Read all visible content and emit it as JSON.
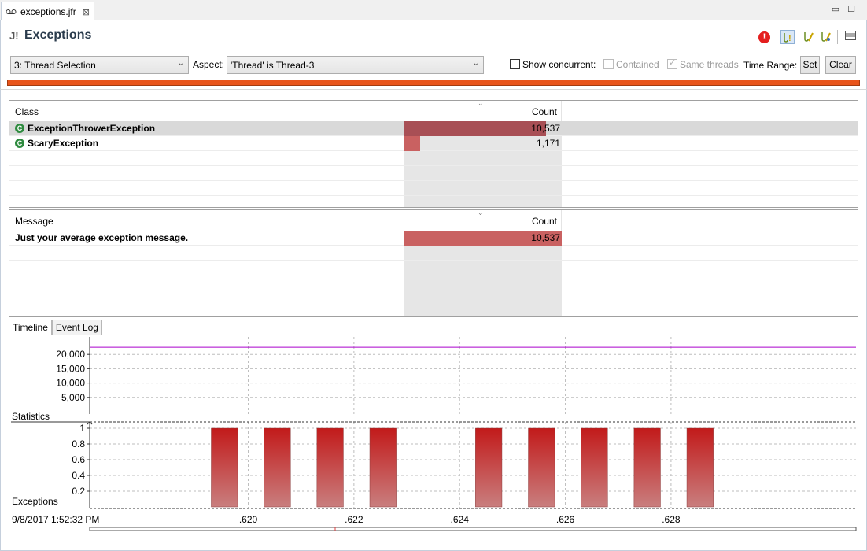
{
  "editor_tab": {
    "label": "exceptions.jfr",
    "close": "⊠"
  },
  "window": {
    "minimize": "▭",
    "maximize": "☐"
  },
  "header": {
    "icon": "J!",
    "title": "Exceptions",
    "error_icon": "!"
  },
  "toolbar": {
    "icons": [
      "show-exceptions-icon",
      "show-errors-icon",
      "show-all-icon",
      "table-settings-icon"
    ]
  },
  "filters": {
    "selection_value": "3: Thread Selection",
    "aspect_label": "Aspect:",
    "aspect_value": "'Thread' is Thread-3",
    "show_concurrent": "Show concurrent:",
    "contained": "Contained",
    "same_threads": "Same threads",
    "time_range": "Time Range:",
    "set": "Set",
    "clear": "Clear"
  },
  "class_table": {
    "headers": {
      "name": "Class",
      "count": "Count"
    },
    "rows": [
      {
        "name": "ExceptionThrowerException",
        "count": "10,537",
        "fraction": 0.902
      },
      {
        "name": "ScaryException",
        "count": "1,171",
        "fraction": 0.1
      }
    ]
  },
  "message_table": {
    "headers": {
      "name": "Message",
      "count": "Count"
    },
    "rows": [
      {
        "name": "Just your average exception message.",
        "count": "10,537",
        "fraction": 1.0
      }
    ]
  },
  "view_tabs": {
    "timeline": "Timeline",
    "event_log": "Event Log"
  },
  "timeline": {
    "start_label": "9/8/2017 1:52:32 PM",
    "x_ticks": [
      ".620",
      ".622",
      ".624",
      ".626",
      ".628"
    ],
    "x_tick_values": [
      0.62,
      0.622,
      0.624,
      0.626,
      0.628
    ],
    "x_range": [
      0.617,
      0.6315
    ],
    "statistics": {
      "label": "Statistics",
      "y_ticks": [
        "5,000",
        "10,000",
        "15,000",
        "20,000"
      ],
      "y_tick_values": [
        5000,
        10000,
        15000,
        20000
      ],
      "y_range": [
        0,
        25000
      ],
      "line_value": 22500,
      "line_color": "#aa00cc"
    },
    "exceptions": {
      "label": "Exceptions",
      "y_ticks": [
        "0.2",
        "0.4",
        "0.6",
        "0.8",
        "1"
      ],
      "y_tick_values": [
        0.2,
        0.4,
        0.6,
        0.8,
        1
      ],
      "y_range": [
        0,
        1
      ],
      "bar_color_top": "#c21a1a",
      "bar_color_bottom": "#c97e7e",
      "bars": [
        {
          "start": 0.6193,
          "end": 0.6198,
          "value": 1
        },
        {
          "start": 0.6203,
          "end": 0.6208,
          "value": 1
        },
        {
          "start": 0.6213,
          "end": 0.6218,
          "value": 1
        },
        {
          "start": 0.6223,
          "end": 0.6228,
          "value": 1
        },
        {
          "start": 0.6243,
          "end": 0.6248,
          "value": 1
        },
        {
          "start": 0.6253,
          "end": 0.6258,
          "value": 1
        },
        {
          "start": 0.6263,
          "end": 0.6268,
          "value": 1
        },
        {
          "start": 0.6273,
          "end": 0.6278,
          "value": 1
        },
        {
          "start": 0.6283,
          "end": 0.6288,
          "value": 1
        }
      ]
    }
  },
  "colors": {
    "range_bar": "#e8541a",
    "selected_bar": "#a84f55",
    "bar": "#c96161"
  }
}
